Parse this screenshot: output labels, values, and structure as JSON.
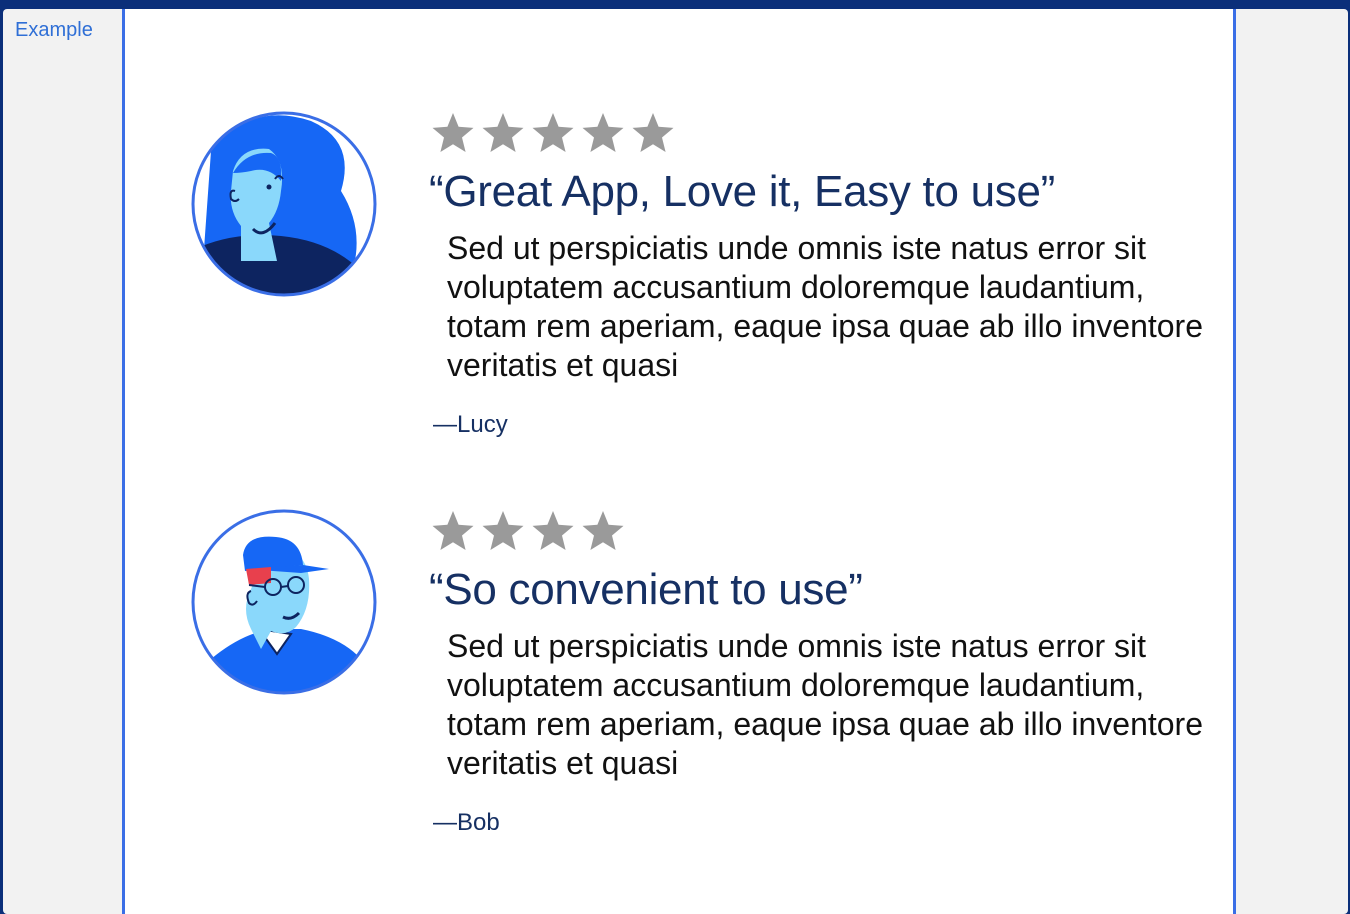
{
  "tab": {
    "label": "Example"
  },
  "colors": {
    "accent": "#3a6ee6",
    "heading": "#163063",
    "star": "#9a9a9a",
    "avatar_blue": "#1667f5",
    "skin": "#8ad8fb",
    "navy": "#0d2460",
    "cap_red": "#e8404d"
  },
  "reviews": [
    {
      "avatar_icon": "woman-avatar-icon",
      "rating": 5,
      "title": "“Great App, Love it, Easy to use”",
      "body": "Sed ut perspiciatis unde omnis iste natus error sit voluptatem accusantium doloremque laudantium, totam rem aperiam, eaque ipsa quae ab illo inventore veritatis et quasi",
      "author": "—Lucy"
    },
    {
      "avatar_icon": "man-avatar-icon",
      "rating": 4,
      "title": "“So convenient to use”",
      "body": "Sed ut perspiciatis unde omnis iste natus error sit voluptatem accusantium doloremque laudantium, totam rem aperiam, eaque ipsa quae ab illo inventore veritatis et quasi",
      "author": "—Bob"
    }
  ]
}
